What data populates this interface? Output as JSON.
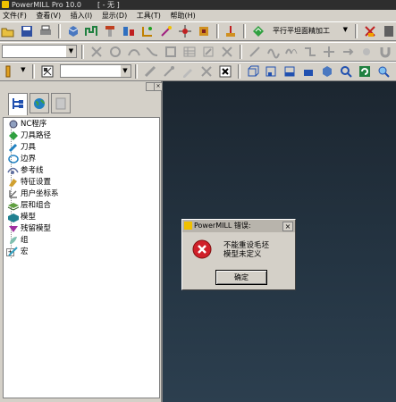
{
  "window": {
    "title": "PowerMILL Pro 10.0",
    "project": "[ - 无 ]"
  },
  "menu": [
    "文件(F)",
    "查看(V)",
    "插入(I)",
    "显示(D)",
    "工具(T)",
    "帮助(H)"
  ],
  "toolbar1": {
    "strategy_label": "平行平坦面精加工"
  },
  "tree": {
    "items": [
      {
        "label": "NC程序",
        "icon": "nc-program-icon"
      },
      {
        "label": "刀具路径",
        "icon": "toolpath-icon"
      },
      {
        "label": "刀具",
        "icon": "tool-icon"
      },
      {
        "label": "边界",
        "icon": "boundary-icon"
      },
      {
        "label": "参考线",
        "icon": "pattern-icon"
      },
      {
        "label": "特征设置",
        "icon": "feature-set-icon"
      },
      {
        "label": "用户坐标系",
        "icon": "workplane-icon"
      },
      {
        "label": "层和组合",
        "icon": "levels-icon"
      },
      {
        "label": "模型",
        "icon": "model-icon"
      },
      {
        "label": "残留模型",
        "icon": "stock-model-icon"
      },
      {
        "label": "组",
        "icon": "group-icon"
      },
      {
        "label": "宏",
        "icon": "macro-icon"
      }
    ],
    "macro_expander": "+"
  },
  "dialog": {
    "title": "PowerMILL 错误:",
    "message_line1": "不能重设毛坯",
    "message_line2": "模型未定义",
    "ok_label": "确定",
    "close_glyph": "×"
  },
  "colors": {
    "viewport_top": "#1c2630",
    "viewport_bottom": "#2c3f4f",
    "error_red": "#d0202a"
  }
}
